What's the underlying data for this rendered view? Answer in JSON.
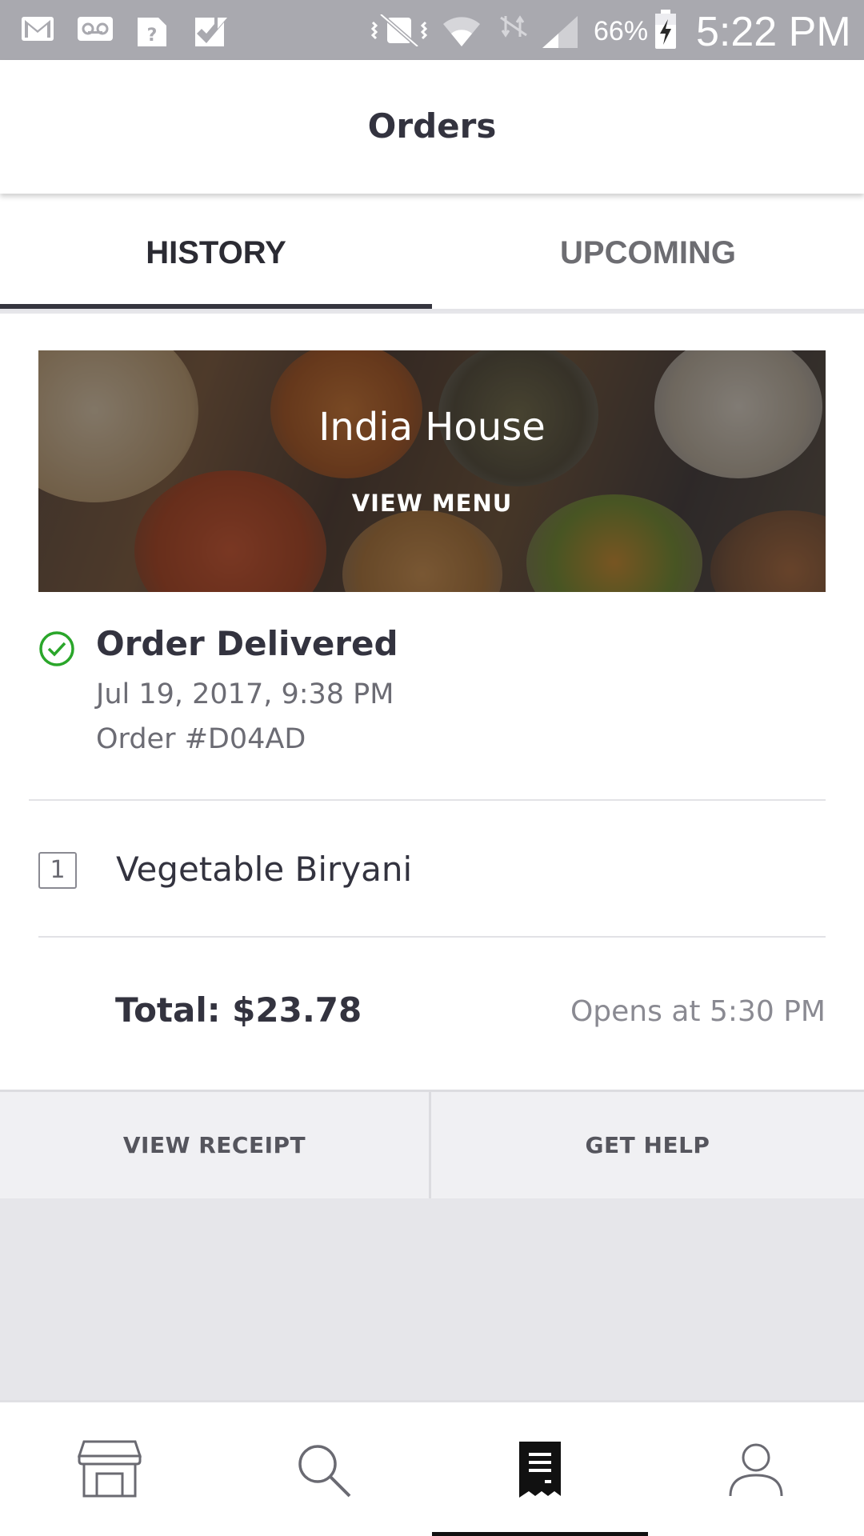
{
  "status_bar": {
    "battery": "66%",
    "time": "5:22 PM",
    "icons": [
      "gmail-icon",
      "voicemail-icon",
      "unknown-notification-icon",
      "task-check-icon",
      "vibrate-mute-icon",
      "wifi-icon",
      "data-off-icon",
      "signal-icon",
      "battery-charging-icon"
    ]
  },
  "header": {
    "title": "Orders"
  },
  "tabs": [
    {
      "label": "HISTORY",
      "active": true
    },
    {
      "label": "UPCOMING",
      "active": false
    }
  ],
  "order": {
    "restaurant": "India House",
    "view_menu": "VIEW MENU",
    "status": "Order Delivered",
    "date": "Jul 19, 2017, 9:38 PM",
    "order_number": "Order #D04AD",
    "items": [
      {
        "quantity": "1",
        "name": "Vegetable Biryani"
      }
    ],
    "total": "Total: $23.78",
    "opens_at": "Opens at 5:30 PM",
    "status_color": "#2aa62a"
  },
  "actions": {
    "view_receipt": "VIEW RECEIPT",
    "get_help": "GET HELP"
  },
  "bottom_nav": {
    "items": [
      "store-icon",
      "search-icon",
      "orders-receipt-icon",
      "profile-icon"
    ],
    "active": "orders-receipt-icon"
  }
}
